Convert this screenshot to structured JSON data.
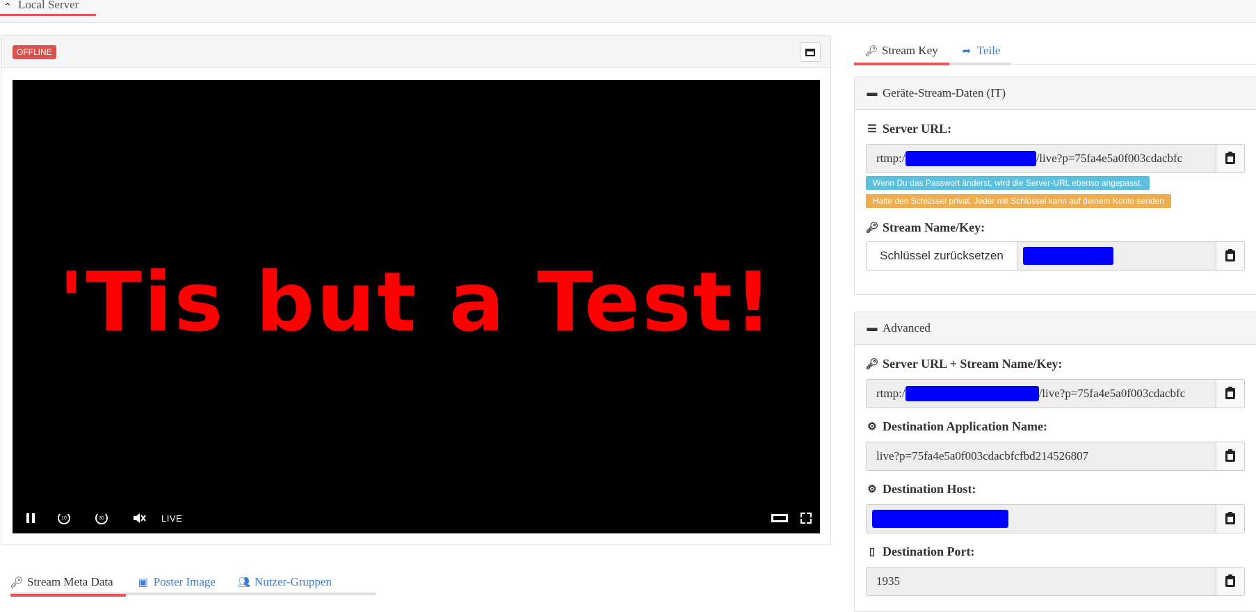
{
  "app": {
    "top_tab_label": "Local Server"
  },
  "player": {
    "status_badge": "OFFLINE",
    "video_text": "'Tis but a Test!",
    "live_label": "LIVE",
    "skip_back_label": "10",
    "skip_forward_label": "30"
  },
  "lower_tabs": [
    {
      "label": "Stream Meta Data"
    },
    {
      "label": "Poster Image"
    },
    {
      "label": "Nutzer-Gruppen"
    }
  ],
  "right_tabs": [
    {
      "label": "Stream Key"
    },
    {
      "label": "Teile"
    }
  ],
  "device_card": {
    "title": "Geräte-Stream-Daten (IT)",
    "server_url_label": "Server URL:",
    "server_url_prefix": "rtmp:/",
    "server_url_suffix": "/live?p=75fa4e5a0f003cdacbfc",
    "hint_info": "Wenn Du das Passwort änderst, wird die Server-URL ebenso angepasst.",
    "hint_warn": "Halte den Schlüssel privat. Jeder mit Schlüssel kann auf deinem Konto senden",
    "stream_key_label": "Stream Name/Key:",
    "reset_button": "Schlüssel zurücksetzen"
  },
  "advanced_card": {
    "title": "Advanced",
    "combined_label": "Server URL + Stream Name/Key:",
    "combined_prefix": "rtmp:/",
    "combined_suffix": "/live?p=75fa4e5a0f003cdacbfc",
    "app_name_label": "Destination Application Name:",
    "app_name_value": "live?p=75fa4e5a0f003cdacbfcfbd214526807",
    "host_label": "Destination Host:",
    "port_label": "Destination Port:",
    "port_value": "1935"
  },
  "colors": {
    "accent": "#e8545a",
    "link": "#3b7dd8",
    "offline": "#d9534f",
    "info": "#5bc0de",
    "warn": "#f0ad4e",
    "redact": "#0000ff"
  }
}
